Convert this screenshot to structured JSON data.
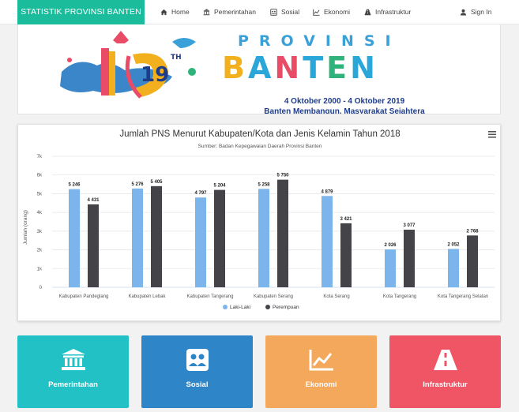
{
  "navbar": {
    "brand": "STATISTIK PROVINSI BANTEN",
    "items": [
      {
        "label": "Home",
        "icon": "home-icon"
      },
      {
        "label": "Pemerintahan",
        "icon": "institution-icon"
      },
      {
        "label": "Sosial",
        "icon": "users-icon"
      },
      {
        "label": "Ekonomi",
        "icon": "line-chart-icon"
      },
      {
        "label": "Infrastruktur",
        "icon": "road-icon"
      }
    ],
    "signin": "Sign In"
  },
  "banner": {
    "anniversary": "19",
    "anniversary_suffix": "TH",
    "title": "PROVINSI",
    "word": "BANTEN",
    "date": "4 Oktober 2000 - 4 Oktober 2019",
    "motto": "Banten Membangun, Masyarakat Sejahtera"
  },
  "chart_data": {
    "type": "bar",
    "title": "Jumlah PNS Menurut Kabupaten/Kota dan Jenis Kelamin Tahun 2018",
    "subtitle": "Sumber: Badan Kepegawaian Daerah Provinsi Banten",
    "ylabel": "Jumlah (orang)",
    "ylim": [
      0,
      7000
    ],
    "yticks": [
      "0",
      "1k",
      "2k",
      "3k",
      "4k",
      "5k",
      "6k",
      "7k"
    ],
    "categories": [
      "Kabupaten Pandeglang",
      "Kabupaten Lebak",
      "Kabupaten Tangerang",
      "Kabupaten Serang",
      "Kota Serang",
      "Kota Tangerang",
      "Kota Tangerang Selatan"
    ],
    "series": [
      {
        "name": "Laki-Laki",
        "color": "#7cb5ec",
        "values": [
          5246,
          5276,
          4797,
          5258,
          4879,
          2026,
          2052
        ],
        "labels": [
          "5 246",
          "5 276",
          "4 797",
          "5 258",
          "4 879",
          "2 026",
          "2 052"
        ]
      },
      {
        "name": "Perempuan",
        "color": "#434348",
        "values": [
          4431,
          5405,
          5204,
          5750,
          3421,
          3077,
          2768
        ],
        "labels": [
          "4 431",
          "5 405",
          "5 204",
          "5 750",
          "3 421",
          "3 077",
          "2 768"
        ]
      }
    ],
    "grid": true,
    "legend": "bottom-center"
  },
  "tiles": [
    {
      "label": "Pemerintahan",
      "icon": "institution-icon",
      "color": "#21c1c5"
    },
    {
      "label": "Sosial",
      "icon": "users-icon",
      "color": "#2e86c9"
    },
    {
      "label": "Ekonomi",
      "icon": "line-chart-icon",
      "color": "#f4a85b"
    },
    {
      "label": "Infrastruktur",
      "icon": "road-icon",
      "color": "#ef5564"
    }
  ]
}
